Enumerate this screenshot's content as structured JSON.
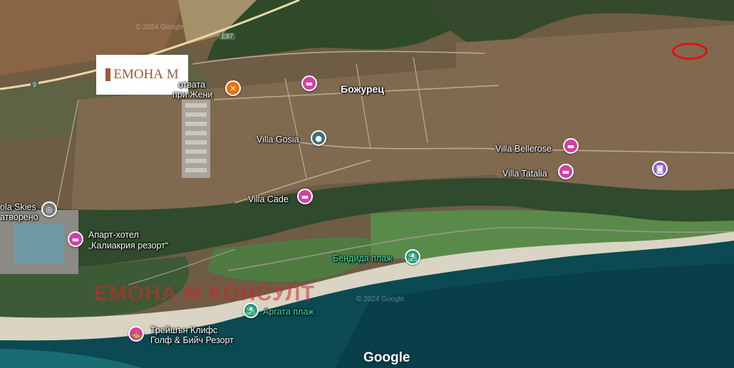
{
  "map": {
    "roads": {
      "e87": "E87",
      "nine": "9"
    },
    "logo": {
      "text": "ЕМОНА М"
    },
    "watermark": "ЕМОНА М КОНСУЛТ",
    "google": "Google",
    "copyright_top": "© 2024 Google",
    "copyright_mid": "© 2024 Google",
    "marker_color": "#e21010",
    "places": [
      {
        "name": "Божурец",
        "icon": "town"
      },
      {
        "name": "Villa Gosia",
        "icon": "place-icon"
      },
      {
        "name": "Villa Bellerose",
        "icon": "hotel-icon"
      },
      {
        "name": "Villa Tatalia",
        "icon": "hotel-icon"
      },
      {
        "name": "Villa Cade",
        "icon": "hotel-icon"
      },
      {
        "name": "Апарт-хотел\n„Калиакрия резорт“",
        "line1": "Апарт-хотел",
        "line2": "„Калиакрия резорт“",
        "icon": "hotel-icon"
      },
      {
        "name": "Бендида плаж",
        "icon": "beach-icon"
      },
      {
        "name": "Аргата плаж",
        "icon": "beach-icon"
      },
      {
        "line1": "Трейшън Клифс",
        "line2": "Голф & Бийч Резорт",
        "icon": "golf-icon"
      },
      {
        "line1": "отвата",
        "line2": "при Жени",
        "icon": "restaurant-icon"
      },
      {
        "line1": "ola Skies",
        "line2": "атворено",
        "icon": "place-icon"
      }
    ]
  }
}
